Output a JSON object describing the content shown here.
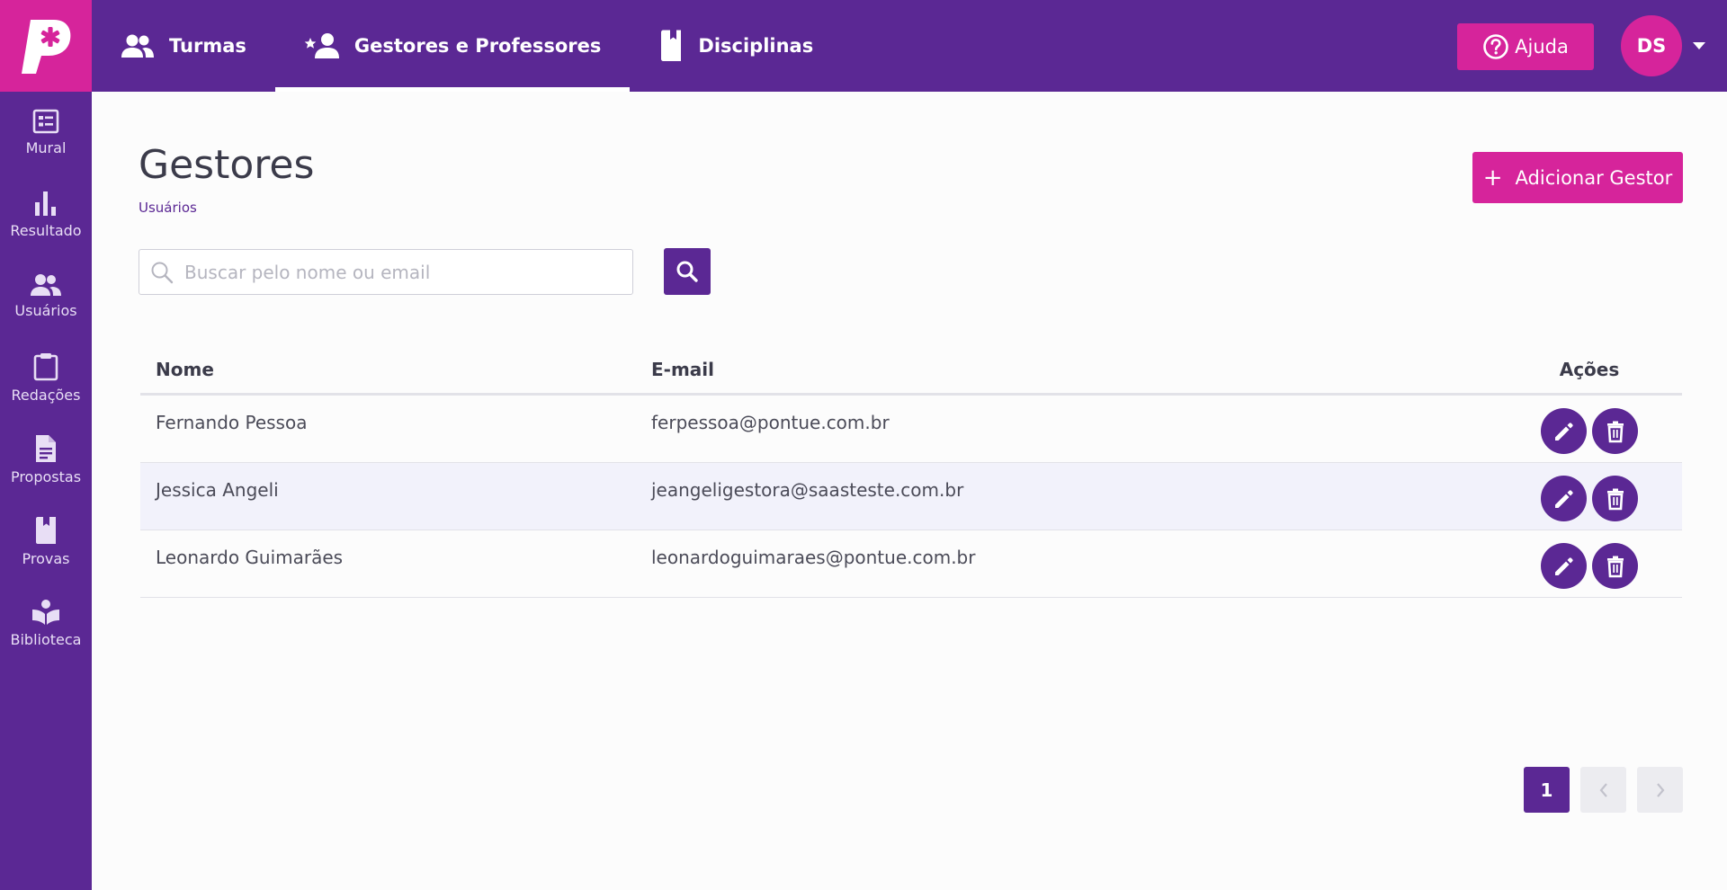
{
  "app": {
    "brand_colors": {
      "primary": "#5b2894",
      "accent": "#d6249b"
    }
  },
  "header": {
    "nav": [
      {
        "label": "Turmas",
        "icon": "people-icon",
        "active": false
      },
      {
        "label": "Gestores e Professores",
        "icon": "star-person-icon",
        "active": true
      },
      {
        "label": "Disciplinas",
        "icon": "book-bookmark-icon",
        "active": false
      }
    ],
    "help_label": "Ajuda",
    "avatar_initials": "DS"
  },
  "sidebar": {
    "items": [
      {
        "label": "Mural",
        "icon": "bulletin-board-icon"
      },
      {
        "label": "Resultado",
        "icon": "bar-chart-icon"
      },
      {
        "label": "Usuários",
        "icon": "users-icon"
      },
      {
        "label": "Redações",
        "icon": "clipboard-icon"
      },
      {
        "label": "Propostas",
        "icon": "document-icon"
      },
      {
        "label": "Provas",
        "icon": "book-icon"
      },
      {
        "label": "Biblioteca",
        "icon": "reading-icon"
      }
    ]
  },
  "page": {
    "title": "Gestores",
    "breadcrumb": "Usuários",
    "add_button_label": "Adicionar Gestor"
  },
  "search": {
    "placeholder": "Buscar pelo nome ou email",
    "value": ""
  },
  "table": {
    "headers": {
      "name": "Nome",
      "email": "E-mail",
      "actions": "Ações"
    },
    "rows": [
      {
        "name": "Fernando Pessoa",
        "email": "ferpessoa@pontue.com.br"
      },
      {
        "name": "Jessica Angeli",
        "email": "jeangeligestora@saasteste.com.br"
      },
      {
        "name": "Leonardo Guimarães",
        "email": "leonardoguimaraes@pontue.com.br"
      }
    ]
  },
  "pagination": {
    "current_page": "1"
  }
}
